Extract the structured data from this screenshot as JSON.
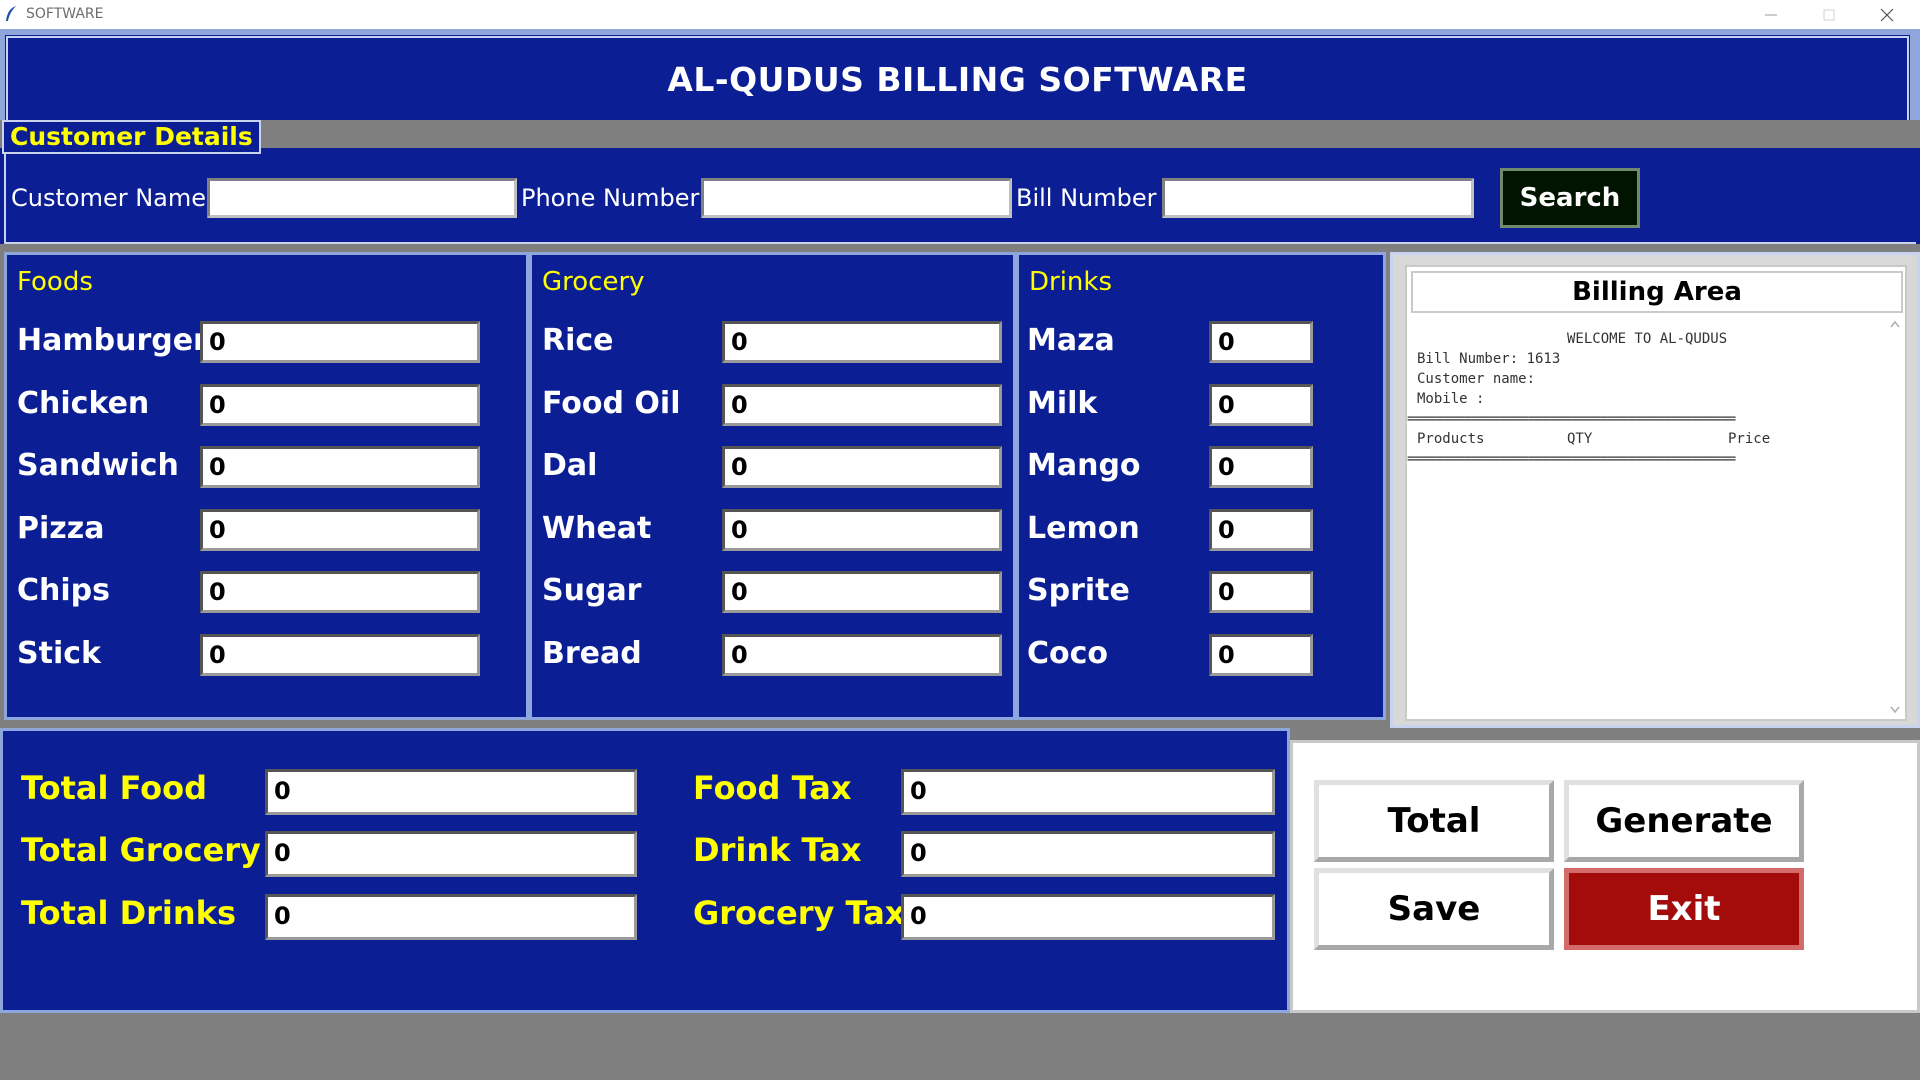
{
  "window": {
    "title": "SOFTWARE"
  },
  "header": {
    "title": "AL-QUDUS BILLING SOFTWARE"
  },
  "customer": {
    "section_label": "Customer Details",
    "name_label": "Customer Name",
    "name_value": "",
    "phone_label": "Phone Number",
    "phone_value": "",
    "bill_label": "Bill Number",
    "bill_value": "",
    "search_label": "Search"
  },
  "foods": {
    "title": "Foods",
    "items": [
      {
        "label": "Hamburger",
        "qty": "0"
      },
      {
        "label": "Chicken",
        "qty": "0"
      },
      {
        "label": "Sandwich",
        "qty": "0"
      },
      {
        "label": "Pizza",
        "qty": "0"
      },
      {
        "label": "Chips",
        "qty": "0"
      },
      {
        "label": "Stick",
        "qty": "0"
      }
    ]
  },
  "grocery": {
    "title": "Grocery",
    "items": [
      {
        "label": "Rice",
        "qty": "0"
      },
      {
        "label": "Food Oil",
        "qty": "0"
      },
      {
        "label": "Dal",
        "qty": "0"
      },
      {
        "label": "Wheat",
        "qty": "0"
      },
      {
        "label": "Sugar",
        "qty": "0"
      },
      {
        "label": "Bread",
        "qty": "0"
      }
    ]
  },
  "drinks": {
    "title": "Drinks",
    "items": [
      {
        "label": "Maza",
        "qty": "0"
      },
      {
        "label": "Milk",
        "qty": "0"
      },
      {
        "label": "Mango",
        "qty": "0"
      },
      {
        "label": "Lemon",
        "qty": "0"
      },
      {
        "label": "Sprite",
        "qty": "0"
      },
      {
        "label": "Coco",
        "qty": "0"
      }
    ]
  },
  "billing": {
    "title": "Billing Area",
    "welcome": "WELCOME TO AL-QUDUS",
    "bill_number_line": "Bill Number: 1613",
    "customer_line": "Customer name:",
    "mobile_line": "Mobile :",
    "separator": "==============================================",
    "col_products": "Products",
    "col_qty": "QTY",
    "col_price": "Price"
  },
  "totals": {
    "total_food_label": "Total Food",
    "total_food_value": "0",
    "total_grocery_label": "Total Grocery",
    "total_grocery_value": "0",
    "total_drinks_label": "Total Drinks",
    "total_drinks_value": "0",
    "food_tax_label": "Food Tax",
    "food_tax_value": "0",
    "drink_tax_label": "Drink Tax",
    "drink_tax_value": "0",
    "grocery_tax_label": "Grocery Tax",
    "grocery_tax_value": "0"
  },
  "buttons": {
    "total": "Total",
    "generate": "Generate",
    "save": "Save",
    "exit": "Exit"
  },
  "colors": {
    "panel_blue": "#0b1e94",
    "label_yellow": "#ffff00",
    "exit_red": "#a40c0c",
    "search_dark": "#001400"
  }
}
